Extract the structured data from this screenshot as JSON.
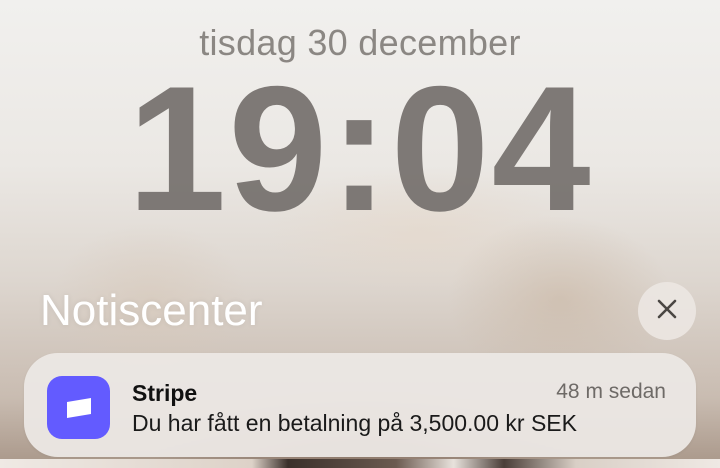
{
  "lockscreen": {
    "date": "tisdag 30 december",
    "time": "19:04"
  },
  "notification_center": {
    "title": "Notiscenter",
    "close_icon": "close-icon"
  },
  "notification": {
    "app_name": "Stripe",
    "time_ago": "48 m sedan",
    "body": "Du har fått en betalning på 3,500.00 kr SEK",
    "icon": "stripe-app-icon",
    "icon_color": "#635bff"
  }
}
